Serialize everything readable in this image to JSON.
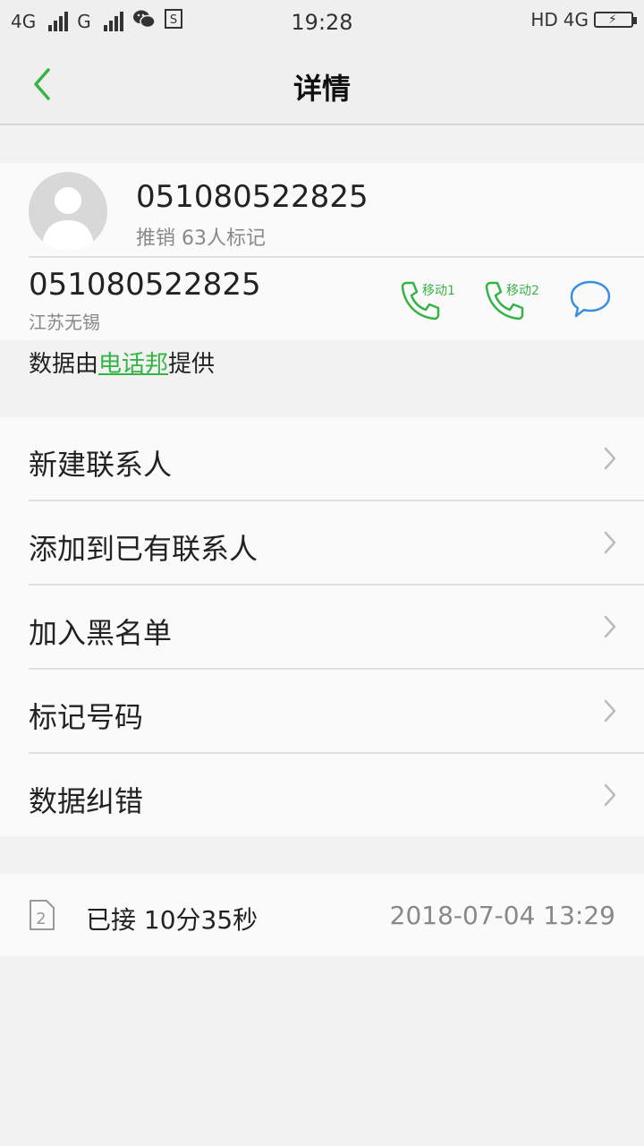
{
  "statusbar": {
    "network1": "4G",
    "network2": "G",
    "time": "19:28",
    "hd": "HD",
    "network3": "4G"
  },
  "header": {
    "title": "详情"
  },
  "contact": {
    "number": "051080522825",
    "tag": "推销 63人标记",
    "number_sub": "051080522825",
    "location": "江苏无锡",
    "call1_label": "移动1",
    "call2_label": "移动2"
  },
  "provider": {
    "prefix": "数据由",
    "link": "电话邦",
    "suffix": "提供"
  },
  "menu": [
    {
      "label": "新建联系人"
    },
    {
      "label": "添加到已有联系人"
    },
    {
      "label": "加入黑名单"
    },
    {
      "label": "标记号码"
    },
    {
      "label": "数据纠错"
    }
  ],
  "call_log": {
    "sim": "2",
    "status": "已接 10分35秒",
    "datetime": "2018-07-04 13:29"
  },
  "colors": {
    "accent": "#35b446",
    "message": "#3b8fe0"
  }
}
